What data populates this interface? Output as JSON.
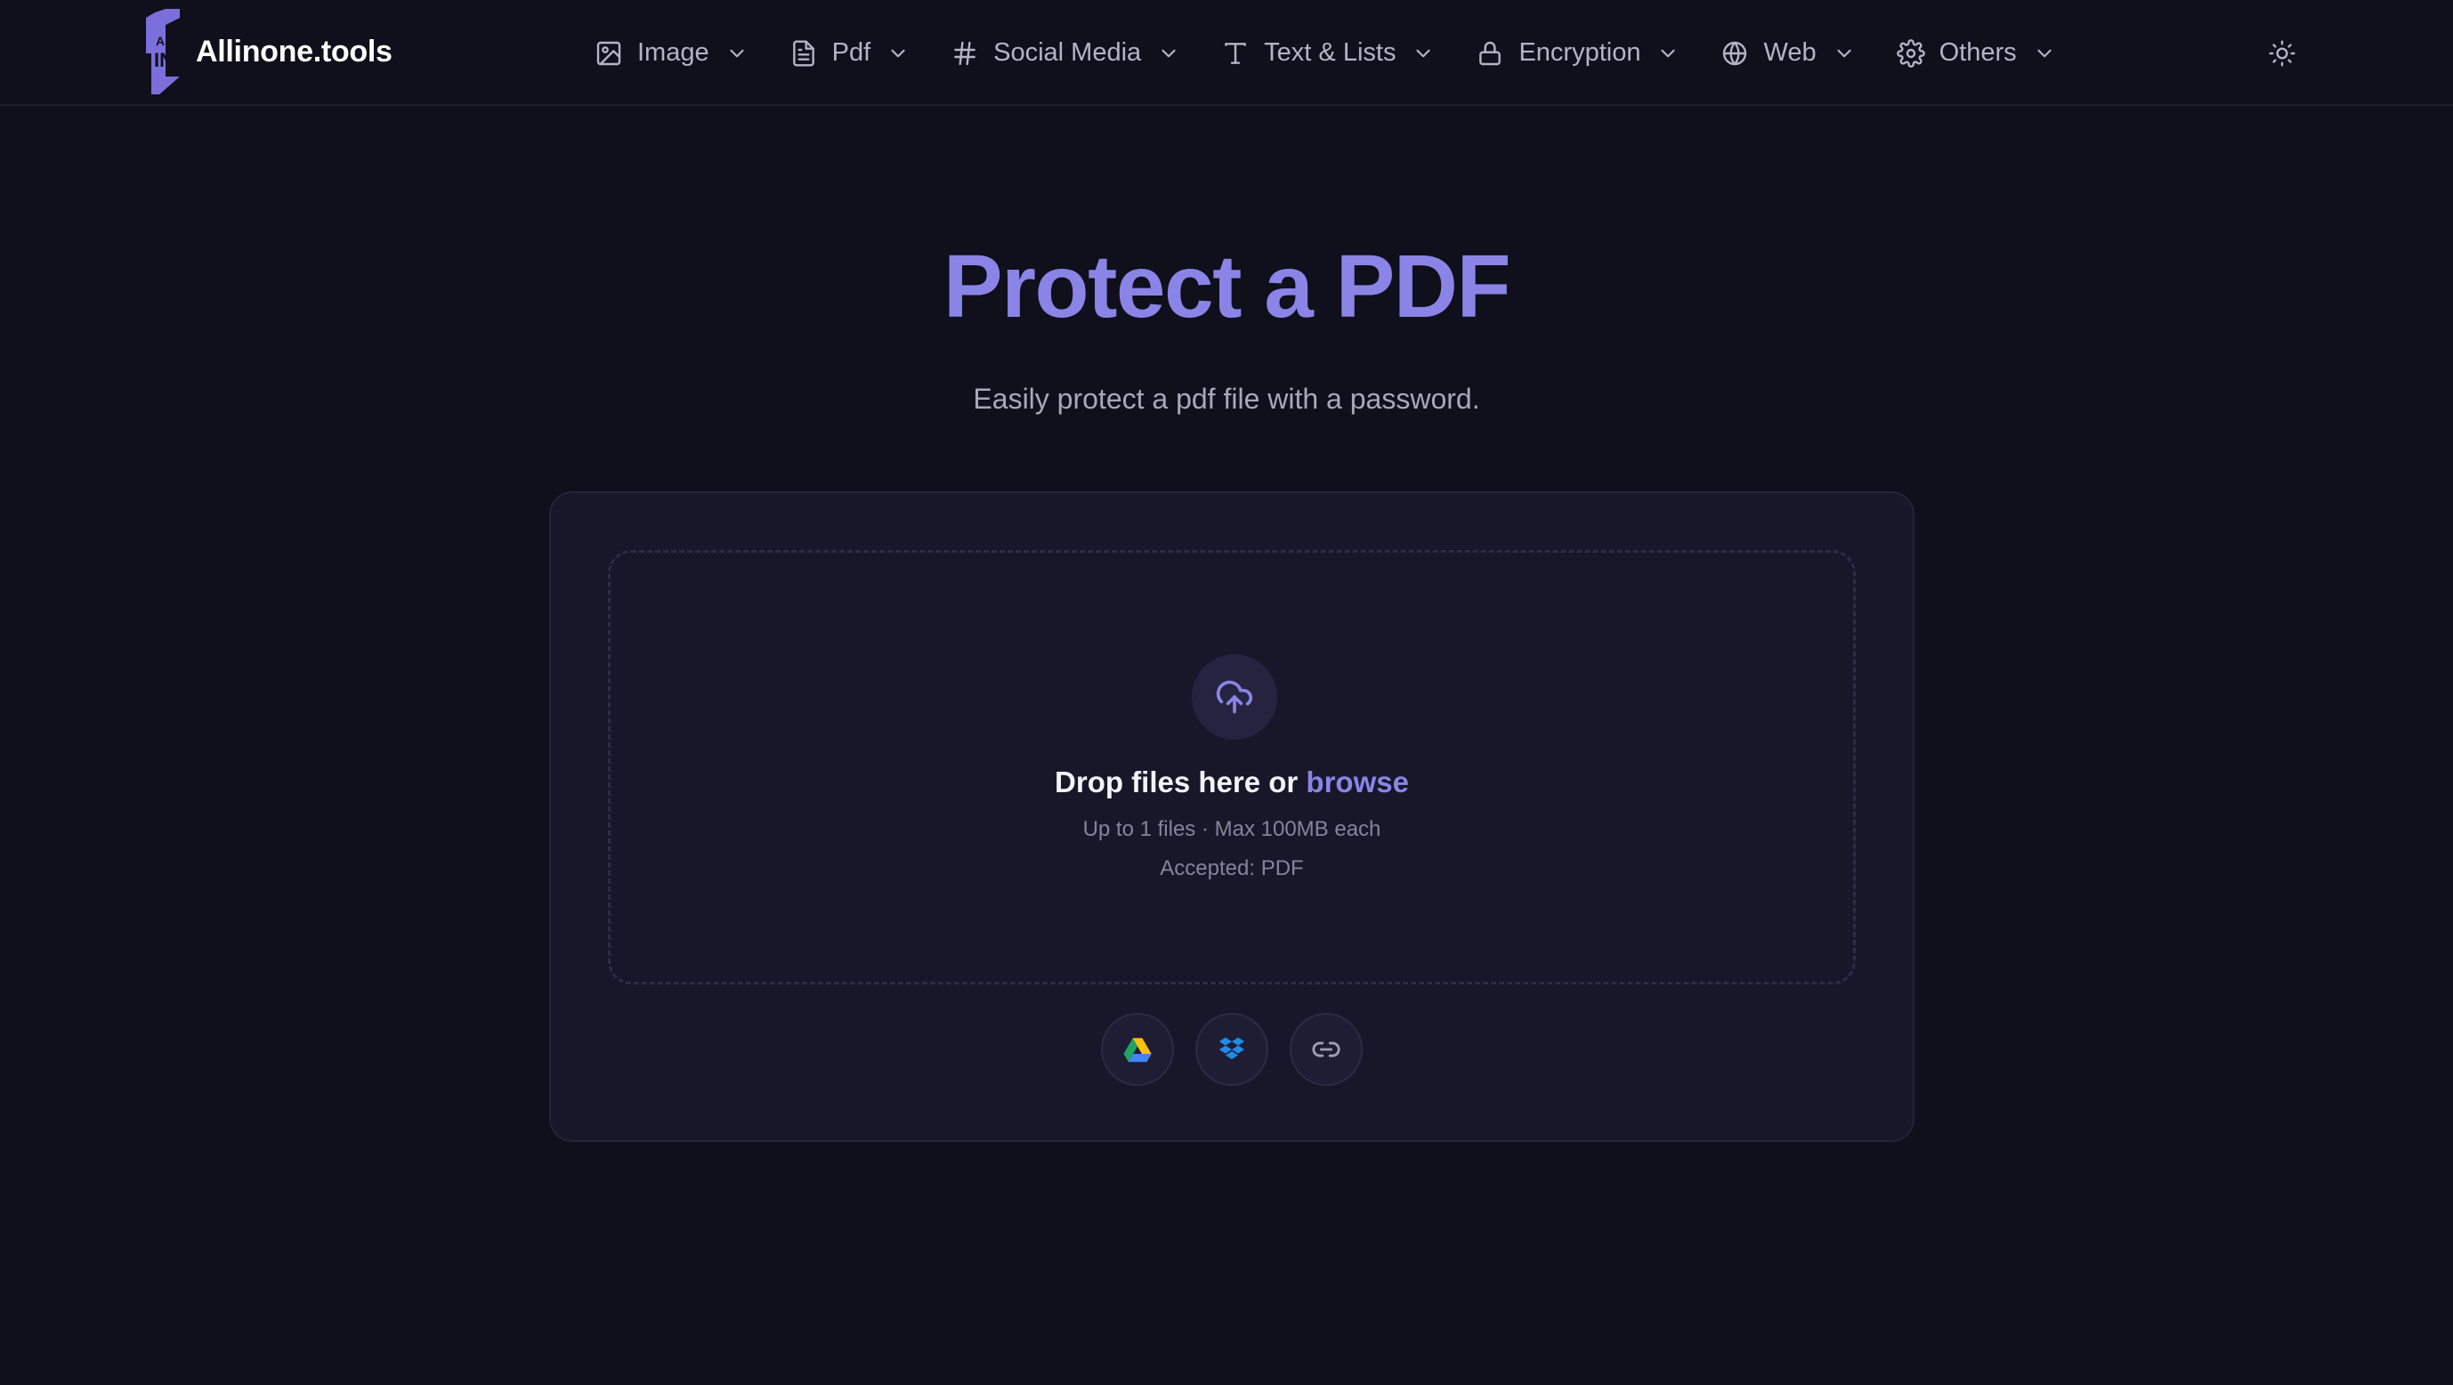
{
  "brand": {
    "name": "Allinone.tools",
    "logo_text_top": "ALL",
    "logo_text_bottom": "IN",
    "accent": "#8a84e6"
  },
  "nav": {
    "items": [
      {
        "label": "Image",
        "icon": "image-icon"
      },
      {
        "label": "Pdf",
        "icon": "file-icon"
      },
      {
        "label": "Social Media",
        "icon": "hash-icon"
      },
      {
        "label": "Text & Lists",
        "icon": "text-icon"
      },
      {
        "label": "Encryption",
        "icon": "lock-icon"
      },
      {
        "label": "Web",
        "icon": "globe-icon"
      },
      {
        "label": "Others",
        "icon": "gear-icon"
      }
    ],
    "theme_icon": "sun-icon"
  },
  "page": {
    "title": "Protect a PDF",
    "subtitle": "Easily protect a pdf file with a password."
  },
  "upload": {
    "drop_prefix": "Drop files here or ",
    "browse_label": "browse",
    "limits": "Up to 1 files · Max 100MB each",
    "accepted": "Accepted: PDF",
    "sources": [
      {
        "icon": "google-drive-icon"
      },
      {
        "icon": "dropbox-icon"
      },
      {
        "icon": "link-icon"
      }
    ]
  }
}
